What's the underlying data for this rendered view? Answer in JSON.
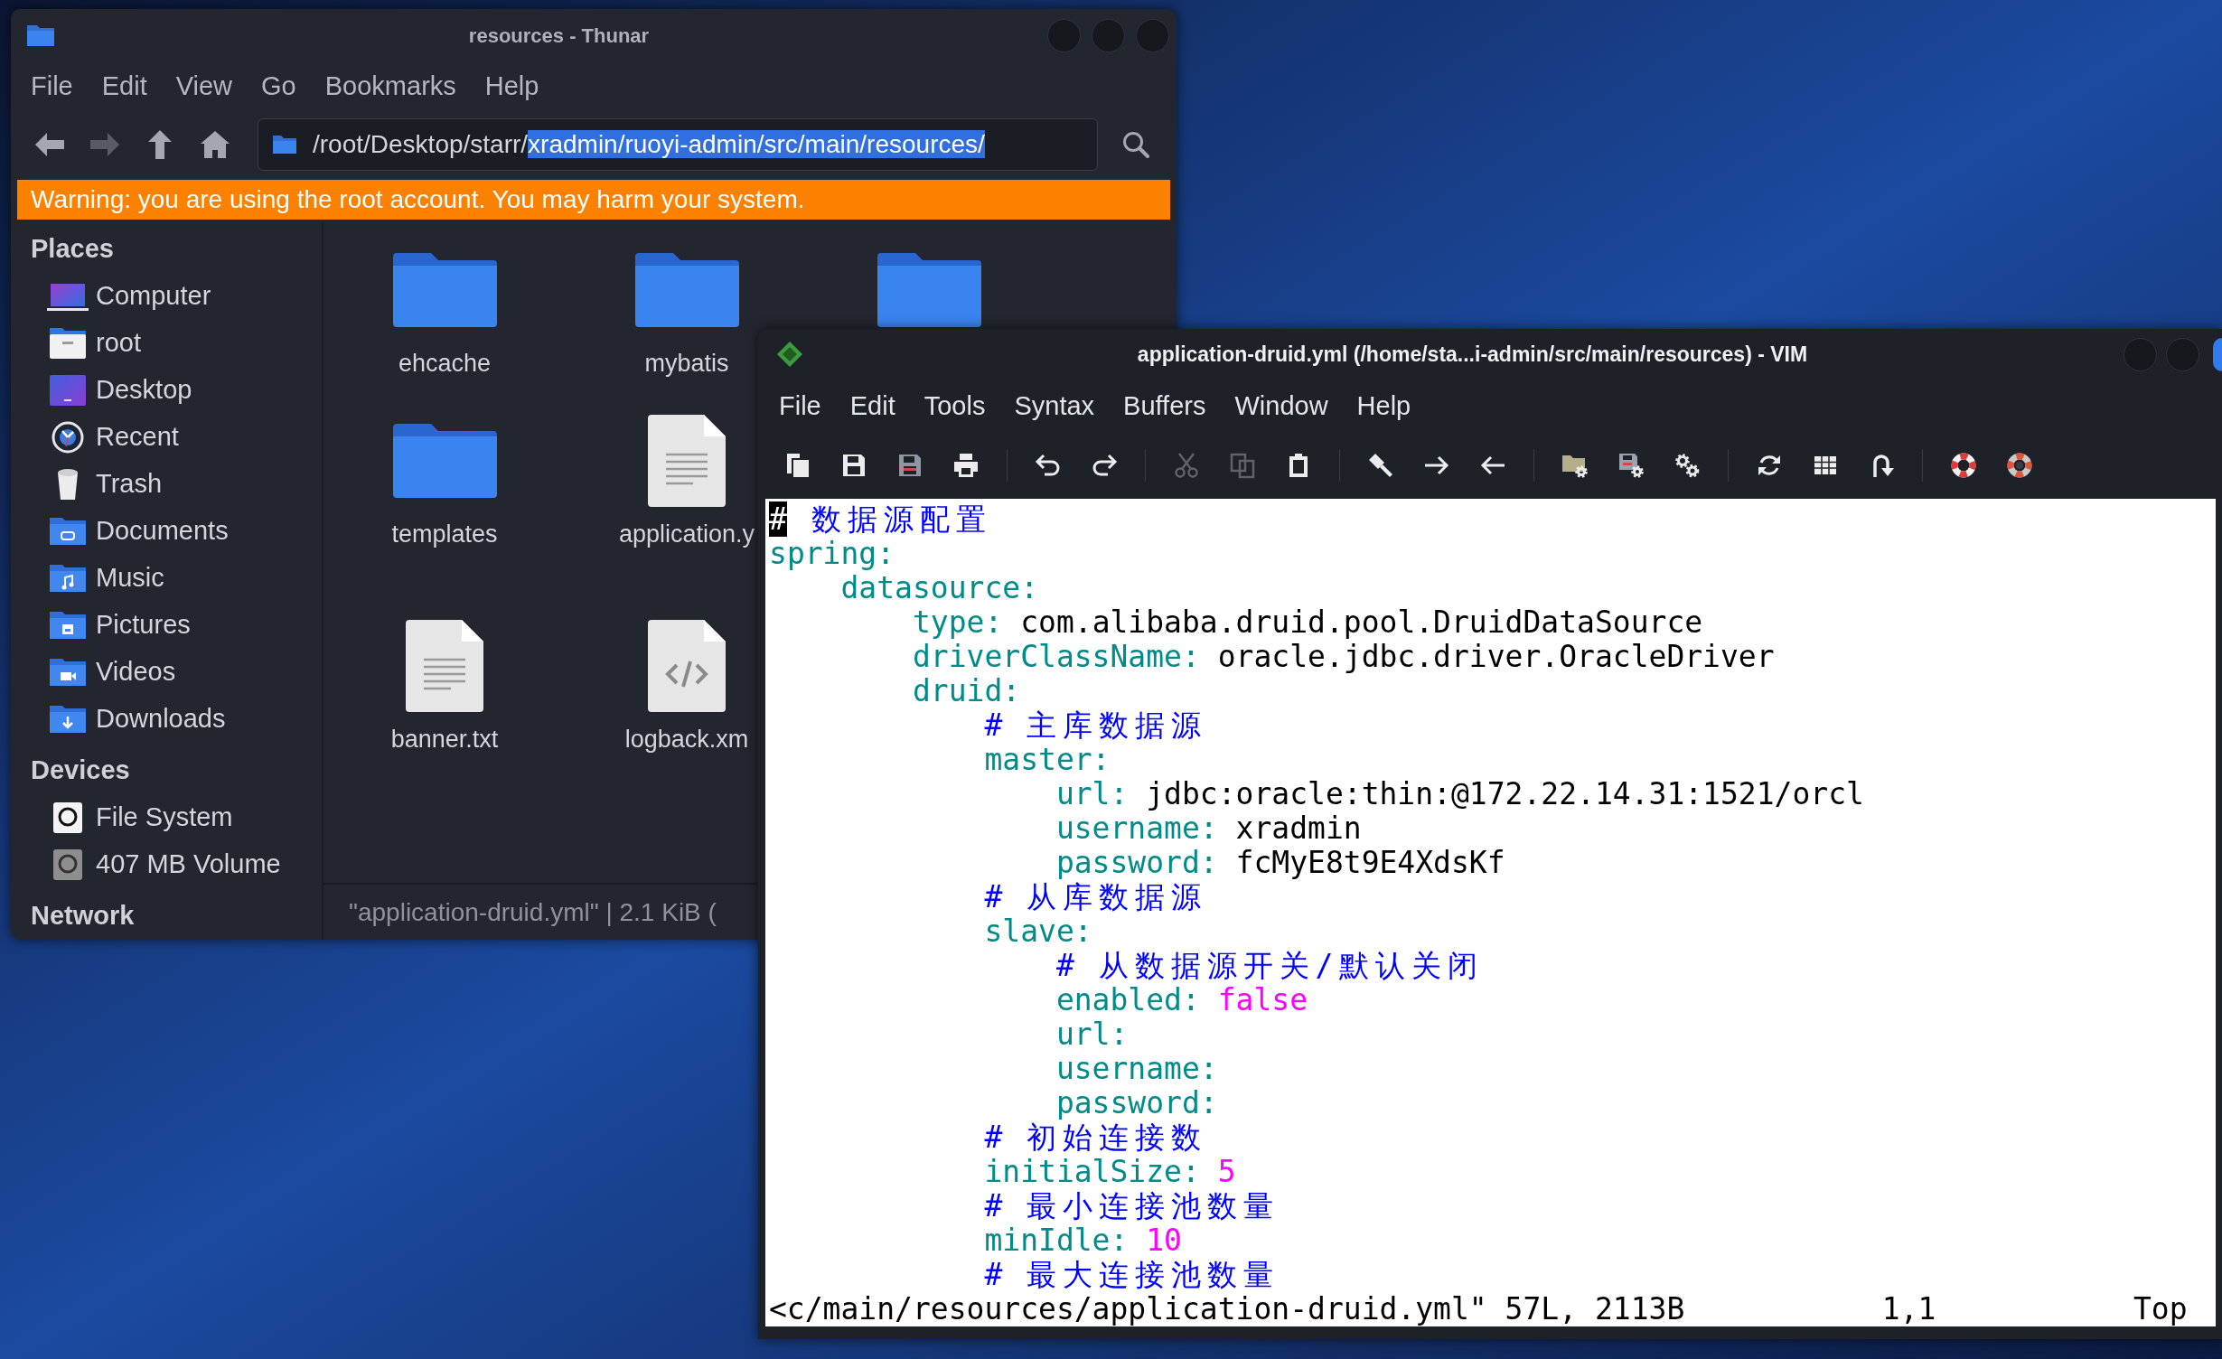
{
  "file_manager": {
    "title": "resources - Thunar",
    "menu": [
      "File",
      "Edit",
      "View",
      "Go",
      "Bookmarks",
      "Help"
    ],
    "toolbar": [
      {
        "kind": "back",
        "disabled": false
      },
      {
        "kind": "forward",
        "disabled": true
      },
      {
        "kind": "up",
        "disabled": false
      },
      {
        "kind": "home",
        "disabled": false
      }
    ],
    "location": {
      "parts": [
        {
          "text": "/root/Desktop/starr/",
          "selected": false
        },
        {
          "text": "xradmin/ruoyi-admin/src/main/resources/",
          "selected": true
        }
      ]
    },
    "warning": "Warning: you are using the root account. You may harm your system.",
    "sidebar": [
      {
        "title": "Places",
        "items": [
          {
            "kind": "computer",
            "label": "Computer",
            "selected": false
          },
          {
            "kind": "home",
            "label": "root",
            "selected": false
          },
          {
            "kind": "desktop",
            "label": "Desktop",
            "selected": false
          },
          {
            "kind": "recent",
            "label": "Recent",
            "selected": false
          },
          {
            "kind": "trash",
            "label": "Trash",
            "selected": false
          },
          {
            "kind": "documents",
            "label": "Documents",
            "selected": false
          },
          {
            "kind": "music",
            "label": "Music",
            "selected": false
          },
          {
            "kind": "pictures",
            "label": "Pictures",
            "selected": false
          },
          {
            "kind": "videos",
            "label": "Videos",
            "selected": false
          },
          {
            "kind": "downloads",
            "label": "Downloads",
            "selected": false
          }
        ]
      },
      {
        "title": "Devices",
        "items": [
          {
            "kind": "drive",
            "label": "File System",
            "selected": false
          },
          {
            "kind": "volume",
            "label": "407 MB Volume",
            "selected": false
          }
        ]
      },
      {
        "title": "Network"
      }
    ],
    "file_rows": [
      [
        {
          "kind": "folder",
          "label": "ehcache",
          "selected": false
        },
        {
          "kind": "folder",
          "label": "mybatis",
          "selected": false
        },
        {
          "kind": "folder",
          "selected": false
        }
      ],
      [
        {
          "kind": "folder",
          "label": "templates",
          "selected": false
        },
        {
          "kind": "document",
          "label": "application.y",
          "selected": false
        }
      ],
      [
        {
          "kind": "document",
          "label": "banner.txt",
          "selected": false
        },
        {
          "kind": "code",
          "label": "logback.xm",
          "selected": false
        }
      ]
    ],
    "status": "\"application-druid.yml\" | 2.1 KiB ("
  },
  "editor": {
    "title": "application-druid.yml (/home/sta...i-admin/src/main/resources) - VIM",
    "menu": [
      "File",
      "Edit",
      "Tools",
      "Syntax",
      "Buffers",
      "Window",
      "Help"
    ],
    "toolbar": [
      [
        {
          "kind": "open",
          "disabled": false
        },
        {
          "kind": "save",
          "disabled": false
        },
        {
          "kind": "saveall",
          "disabled": false
        },
        {
          "kind": "print",
          "disabled": false
        }
      ],
      [
        {
          "kind": "undo",
          "disabled": false
        },
        {
          "kind": "redo",
          "disabled": false
        }
      ],
      [
        {
          "kind": "cut",
          "disabled": true
        },
        {
          "kind": "copy",
          "disabled": true
        },
        {
          "kind": "paste",
          "disabled": false
        }
      ],
      [
        {
          "kind": "replace",
          "disabled": false
        },
        {
          "kind": "findnext",
          "disabled": false
        },
        {
          "kind": "findprev",
          "disabled": false
        }
      ],
      [
        {
          "kind": "loadsession",
          "disabled": false
        },
        {
          "kind": "savesession",
          "disabled": false
        },
        {
          "kind": "script",
          "disabled": false
        }
      ],
      [
        {
          "kind": "make",
          "disabled": false
        },
        {
          "kind": "tags",
          "disabled": false
        },
        {
          "kind": "jump",
          "disabled": false
        }
      ],
      [
        {
          "kind": "help",
          "disabled": false
        },
        {
          "kind": "findhelp",
          "disabled": false
        }
      ]
    ],
    "buffer": [
      {
        "kind": "comment",
        "text": "# 数据源配置",
        "cursor": true
      },
      {
        "kind": "entry",
        "key": "spring:",
        "cursor": false,
        "children": [
          {
            "kind": "entry",
            "key": "datasource:",
            "cursor": false,
            "children": [
              {
                "kind": "entry",
                "key": "type:",
                "value": {
                  "kind": "string",
                  "text": "com.alibaba.druid.pool.DruidDataSource"
                },
                "cursor": false
              },
              {
                "kind": "entry",
                "key": "driverClassName:",
                "value": {
                  "kind": "string",
                  "text": "oracle.jdbc.driver.OracleDriver"
                },
                "cursor": false
              },
              {
                "kind": "entry",
                "key": "druid:",
                "cursor": false,
                "children": [
                  {
                    "kind": "comment",
                    "text": "# 主库数据源",
                    "cursor": false
                  },
                  {
                    "kind": "entry",
                    "key": "master:",
                    "cursor": false,
                    "children": [
                      {
                        "kind": "entry",
                        "key": "url:",
                        "value": {
                          "kind": "string",
                          "text": "jdbc:oracle:thin:@172.22.14.31:1521/orcl"
                        },
                        "cursor": false
                      },
                      {
                        "kind": "entry",
                        "key": "username:",
                        "value": {
                          "kind": "string",
                          "text": "xradmin"
                        },
                        "cursor": false
                      },
                      {
                        "kind": "entry",
                        "key": "password:",
                        "value": {
                          "kind": "string",
                          "text": "fcMyE8t9E4XdsKf"
                        },
                        "cursor": false
                      }
                    ]
                  },
                  {
                    "kind": "comment",
                    "text": "# 从库数据源",
                    "cursor": false
                  },
                  {
                    "kind": "entry",
                    "key": "slave:",
                    "cursor": false,
                    "children": [
                      {
                        "kind": "comment",
                        "text": "# 从数据源开关/默认关闭",
                        "cursor": false
                      },
                      {
                        "kind": "entry",
                        "key": "enabled:",
                        "value": {
                          "kind": "literal",
                          "text": "false"
                        },
                        "cursor": false
                      },
                      {
                        "kind": "entry",
                        "key": "url:",
                        "cursor": false
                      },
                      {
                        "kind": "entry",
                        "key": "username:",
                        "cursor": false
                      },
                      {
                        "kind": "entry",
                        "key": "password:",
                        "cursor": false
                      }
                    ]
                  },
                  {
                    "kind": "comment",
                    "text": "# 初始连接数",
                    "cursor": false
                  },
                  {
                    "kind": "entry",
                    "key": "initialSize:",
                    "value": {
                      "kind": "literal",
                      "text": "5"
                    },
                    "cursor": false
                  },
                  {
                    "kind": "comment",
                    "text": "# 最小连接池数量",
                    "cursor": false
                  },
                  {
                    "kind": "entry",
                    "key": "minIdle:",
                    "value": {
                      "kind": "literal",
                      "text": "10"
                    },
                    "cursor": false
                  },
                  {
                    "kind": "comment",
                    "text": "# 最大连接池数量",
                    "cursor": false
                  }
                ]
              }
            ]
          }
        ]
      }
    ],
    "command_line": {
      "message": "<c/main/resources/application-druid.yml\" 57L, 2113B",
      "ruler": "1,1",
      "position": "Top"
    }
  }
}
